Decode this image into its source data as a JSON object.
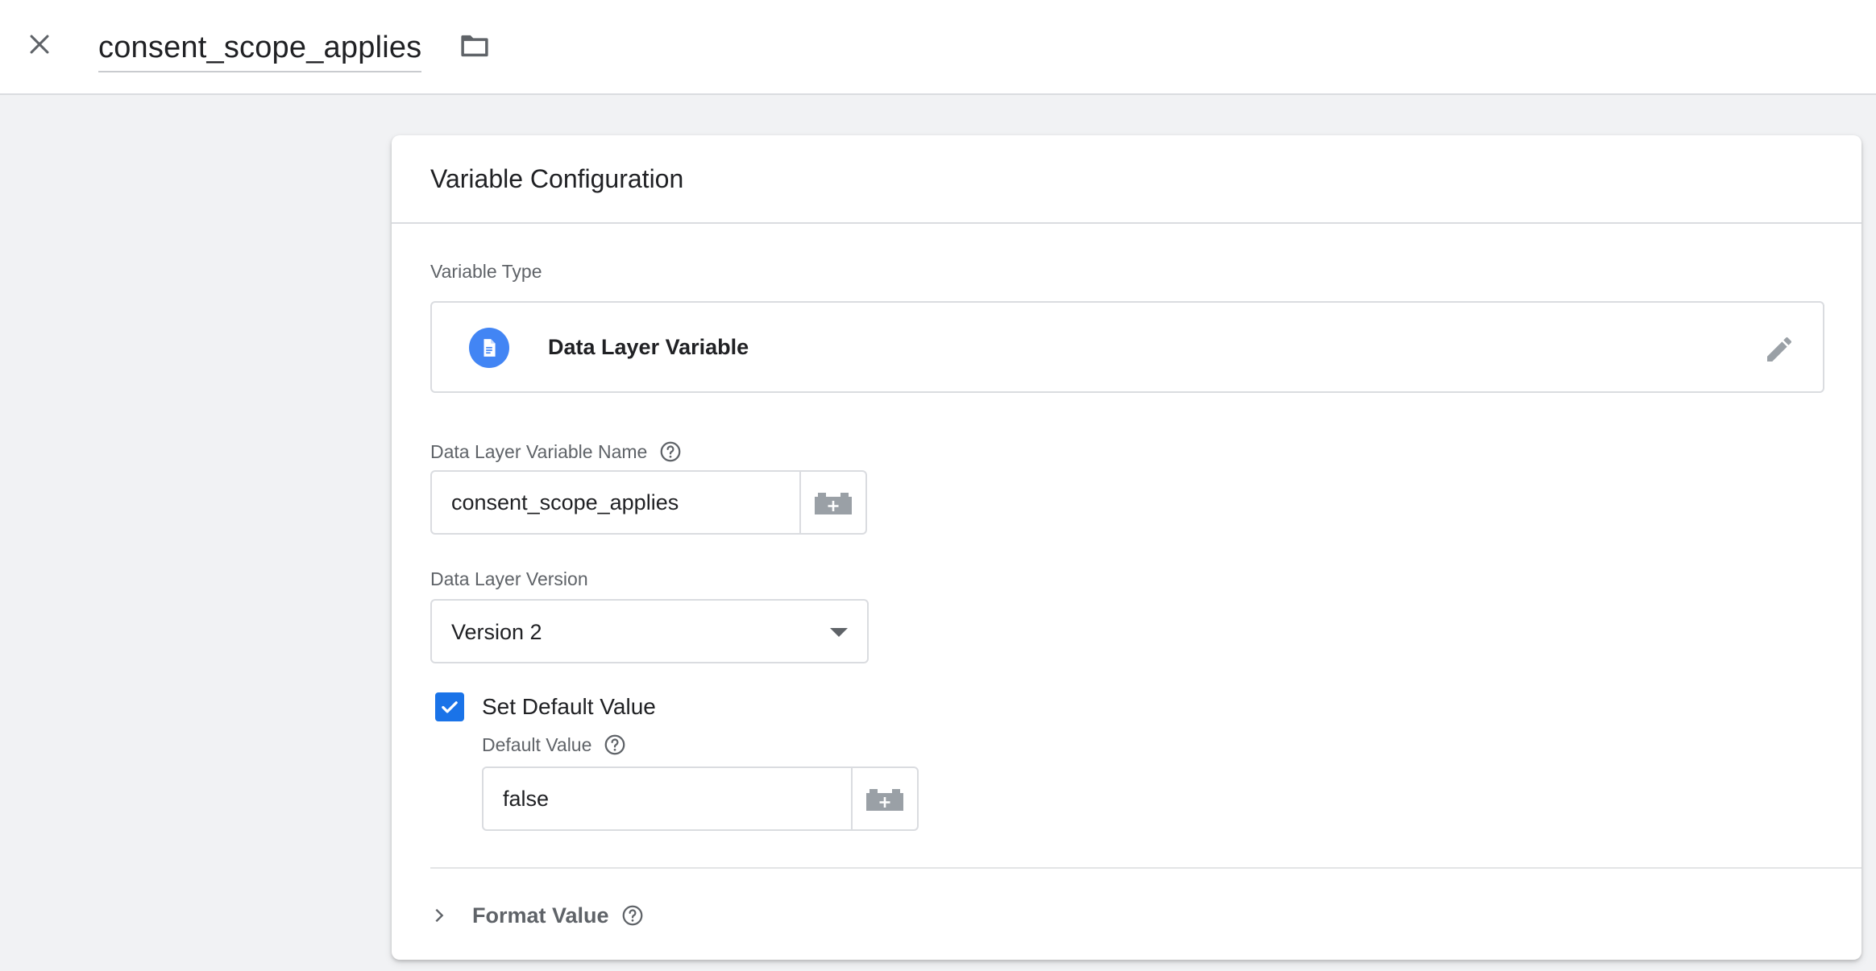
{
  "header": {
    "title": "consent_scope_applies"
  },
  "card": {
    "title": "Variable Configuration",
    "variable_type": {
      "label": "Variable Type",
      "value": "Data Layer Variable"
    },
    "dlv_name": {
      "label": "Data Layer Variable Name",
      "value": "consent_scope_applies"
    },
    "dlv_version": {
      "label": "Data Layer Version",
      "selected": "Version 2"
    },
    "default_value": {
      "checkbox_label": "Set Default Value",
      "checked": true,
      "label": "Default Value",
      "value": "false"
    },
    "format_value": {
      "label": "Format Value"
    }
  },
  "colors": {
    "accent": "#1a73e8",
    "type_icon_bg": "#4285f4",
    "page_bg": "#f1f2f4"
  },
  "icons": {
    "close": "close-icon",
    "folder": "folder-icon",
    "type": "document-icon",
    "edit": "pencil-icon",
    "help": "help-circle-icon",
    "variable": "lego-brick-plus-icon",
    "dropdown": "caret-down-icon",
    "expand": "chevron-right-icon"
  }
}
